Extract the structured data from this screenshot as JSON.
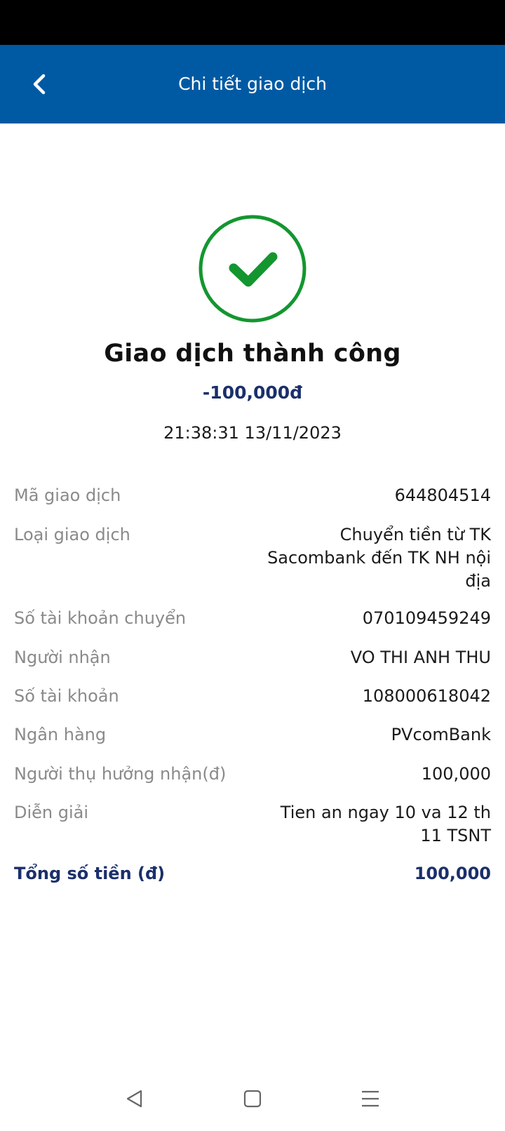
{
  "header": {
    "title": "Chi tiết giao dịch"
  },
  "result": {
    "status": "Giao dịch thành công",
    "amount": "-100,000đ",
    "datetime": "21:38:31 13/11/2023"
  },
  "details": [
    {
      "label": "Mã giao dịch",
      "value": "644804514"
    },
    {
      "label": "Loại giao dịch",
      "value": "Chuyển tiền từ TK Sacombank đến TK NH nội địa"
    },
    {
      "label": "Số tài khoản chuyển",
      "value": "070109459249"
    },
    {
      "label": "Người nhận",
      "value": "VO THI ANH THU"
    },
    {
      "label": "Số tài khoản",
      "value": "108000618042"
    },
    {
      "label": "Ngân hàng",
      "value": "PVcomBank"
    },
    {
      "label": "Người thụ hưởng nhận(đ)",
      "value": "100,000"
    },
    {
      "label": "Diễn giải",
      "value": "Tien an ngay 10 va 12 th 11 TSNT"
    }
  ],
  "total": {
    "label": "Tổng số tiền (đ)",
    "value": "100,000"
  },
  "colors": {
    "app_bar": "#005aa3",
    "success_green": "#13962f",
    "amount_navy": "#1b2f6b",
    "label_gray": "#8a8a8a"
  },
  "icons": {
    "back": "chevron-left-icon",
    "success": "check-circle-icon",
    "nav_back": "triangle-back-icon",
    "nav_home": "square-home-icon",
    "nav_menu": "menu-lines-icon"
  }
}
